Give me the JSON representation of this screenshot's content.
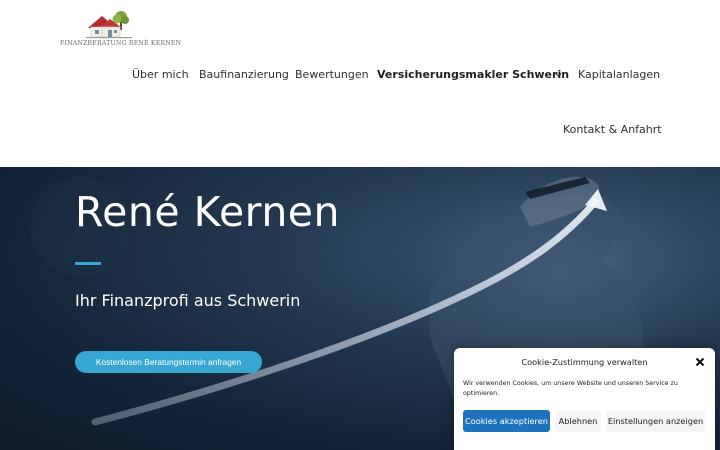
{
  "logo": {
    "text": "FINANZBERATUNG RENÉ KERNEN",
    "icon": "house-with-tree-logo"
  },
  "nav": {
    "items": [
      {
        "label": "Über mich"
      },
      {
        "label": "Baufinanzierung"
      },
      {
        "label": "Bewertungen"
      },
      {
        "label": "Versicherungsmakler Schwerin",
        "active": true,
        "has_submenu": true
      },
      {
        "label": "Kapitalanlagen"
      },
      {
        "label": "Kontakt & Anfahrt"
      }
    ]
  },
  "hero": {
    "title": "René Kernen",
    "subtitle": "Ihr Finanzprofi aus Schwerin",
    "cta_label": "Kostenlosen Beratungstermin anfragen",
    "accent_color": "#3aa7d8"
  },
  "cookie": {
    "title": "Cookie-Zustimmung verwalten",
    "text": "Wir verwenden Cookies, um unsere Website und unseren Service zu optimieren.",
    "accept_label": "Cookies akzeptieren",
    "deny_label": "Ablehnen",
    "settings_label": "Einstellungen anzeigen",
    "accept_color": "#1e73be"
  }
}
